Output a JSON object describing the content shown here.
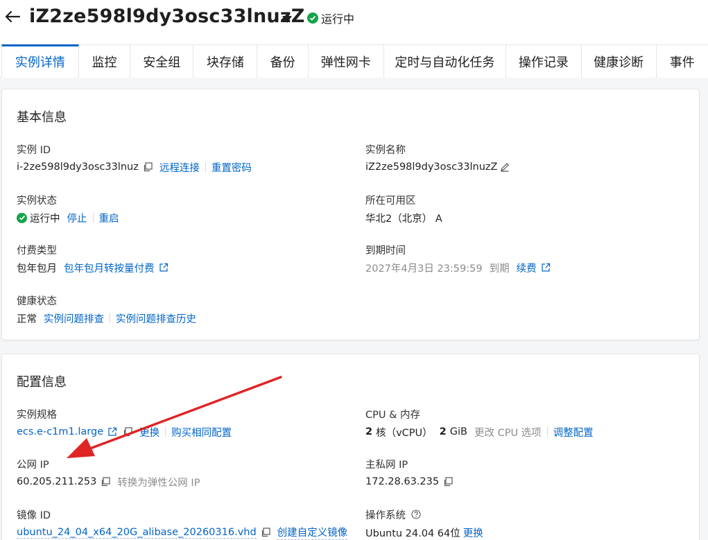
{
  "header": {
    "title": "iZ2ze598l9dy3osc33lnuzZ",
    "status": "运行中"
  },
  "tabs": [
    "实例详情",
    "监控",
    "安全组",
    "块存储",
    "备份",
    "弹性网卡",
    "定时与自动化任务",
    "操作记录",
    "健康诊断",
    "事件"
  ],
  "basic": {
    "title": "基本信息",
    "instance_id_label": "实例 ID",
    "instance_id": "i-2ze598l9dy3osc33lnuz",
    "remote_connect": "远程连接",
    "reset_password": "重置密码",
    "instance_name_label": "实例名称",
    "instance_name": "iZ2ze598l9dy3osc33lnuzZ",
    "state_label": "实例状态",
    "state": "运行中",
    "stop": "停止",
    "restart": "重启",
    "zone_label": "所在可用区",
    "zone": "华北2（北京） A",
    "billing_label": "付费类型",
    "billing": "包年包月",
    "billing_switch": "包年包月转按量付费",
    "expire_label": "到期时间",
    "expire_time": "2027年4月3日 23:59:59",
    "expire_suffix": "到期",
    "renew": "续费",
    "health_label": "健康状态",
    "health": "正常",
    "troubleshoot": "实例问题排查",
    "troubleshoot_history": "实例问题排查历史"
  },
  "config": {
    "title": "配置信息",
    "spec_label": "实例规格",
    "spec": "ecs.e-c1m1.large",
    "change": "更换",
    "buy_same": "购买相同配置",
    "cpu_mem_label": "CPU & 内存",
    "cpu_num": "2",
    "cpu_unit": "核（vCPU）",
    "mem_num": "2",
    "mem_unit": "GiB",
    "change_cpu": "更改 CPU 选项",
    "adjust": "调整配置",
    "public_ip_label": "公网 IP",
    "public_ip": "60.205.211.253",
    "to_eip": "转换为弹性公网 IP",
    "private_ip_label": "主私网 IP",
    "private_ip": "172.28.63.235",
    "image_label": "镜像 ID",
    "image": "ubuntu_24_04_x64_20G_alibase_20260316.vhd",
    "custom_image": "创建自定义镜像",
    "os_label": "操作系统",
    "os": "Ubuntu 24.04 64位",
    "os_change": "更换"
  },
  "colors": {
    "link": "#0064c8",
    "success": "#16a34a",
    "annotation_arrow": "#e02424"
  }
}
